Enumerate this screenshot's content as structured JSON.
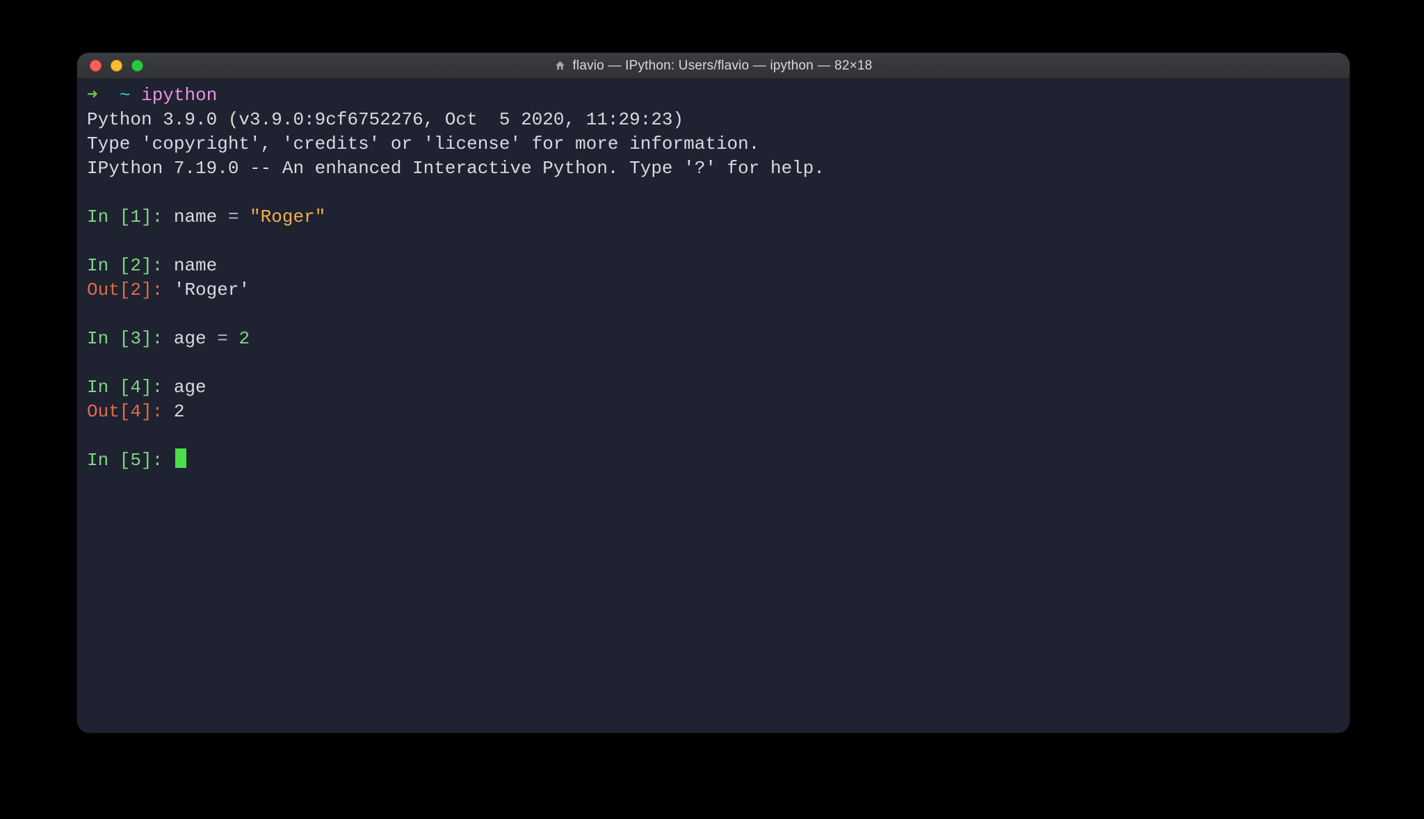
{
  "window": {
    "title": "flavio — IPython: Users/flavio — ipython — 82×18"
  },
  "prompt": {
    "arrow": "➜",
    "tilde": "~",
    "command": "ipython"
  },
  "banner": {
    "line1": "Python 3.9.0 (v3.9.0:9cf6752276, Oct  5 2020, 11:29:23)",
    "line2": "Type 'copyright', 'credits' or 'license' for more information.",
    "line3": "IPython 7.19.0 -- An enhanced Interactive Python. Type '?' for help."
  },
  "cells": {
    "in1_label": "In [",
    "in1_num": "1",
    "in1_close": "]: ",
    "in1_var": "name ",
    "in1_eq": "= ",
    "in1_str": "\"Roger\"",
    "in2_label": "In [",
    "in2_num": "2",
    "in2_close": "]: ",
    "in2_code": "name",
    "out2_label": "Out[",
    "out2_num": "2",
    "out2_close": "]: ",
    "out2_val": "'Roger'",
    "in3_label": "In [",
    "in3_num": "3",
    "in3_close": "]: ",
    "in3_var": "age ",
    "in3_eq": "= ",
    "in3_num2": "2",
    "in4_label": "In [",
    "in4_num": "4",
    "in4_close": "]: ",
    "in4_code": "age",
    "out4_label": "Out[",
    "out4_num": "4",
    "out4_close": "]: ",
    "out4_val": "2",
    "in5_label": "In [",
    "in5_num": "5",
    "in5_close": "]: "
  }
}
